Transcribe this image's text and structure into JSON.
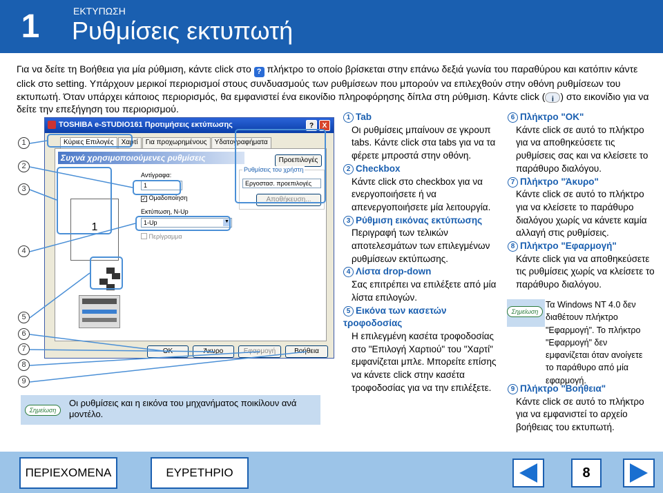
{
  "header": {
    "chapter_number": "1",
    "section_label": "ΕΚΤΥΠΩΣΗ",
    "title": "Ρυθμίσεις εκτυπωτή"
  },
  "intro": {
    "part1": "Για να δείτε τη Βοήθεια για μία ρύθμιση, κάντε click στο",
    "q_icon": "?",
    "part2": "πλήκτρο το οποίο βρίσκεται στην επάνω δεξιά γωνία του παραθύρου και κατόπιν κάντε click στο setting. Υπάρχουν μερικοί περιορισμοί στους συνδυασμούς των ρυθμίσεων που μπορούν να επιλεχθούν στην οθόνη ρυθμίσεων του εκτυπωτή. Όταν υπάρχει κάποιος περιορισμός, θα εμφανιστεί ένα εικονίδιο πληροφόρησης δίπλα στη ρύθμιση. Κάντε click (",
    "i_icon": "i",
    "part3": ") στο εικονίδιο για να δείτε την επεξήγηση του περιορισμού."
  },
  "callouts": [
    "1",
    "2",
    "3",
    "4",
    "5",
    "6",
    "7",
    "8",
    "9"
  ],
  "dialog": {
    "title": "TOSHIBA e-STUDIO161 Προτιμήσεις εκτύπωσης",
    "help_btn": "?",
    "close_btn": "X",
    "tabs": [
      "Κύριες Επιλογές",
      "Χαρτί",
      "Για προχωρημένους",
      "Υδατογραφήματα"
    ],
    "banner": "Συχνά χρησιμοποιούμενες ρυθμίσεις",
    "defaults_btn": "Προεπιλογές",
    "preview_number": "1",
    "copies_label": "Αντίγραφα:",
    "copies_value": "1",
    "collate_label": "Ομαδοποίηση",
    "user_settings_label": "Ρυθμίσεις του χρήστη",
    "user_settings_value": "Εργοστασ. προεπιλογές",
    "save_btn": "Αποθήκευση...",
    "nup_label": "Εκτύπωση, N-Up",
    "nup_value": "1-Up",
    "border_label": "Περίγραμμα",
    "ok_btn": "OK",
    "cancel_btn": "Άκυρο",
    "apply_btn": "Εφαρμογή",
    "help_bottom_btn": "Βοήθεια"
  },
  "note": {
    "badge": "Σημείωση",
    "text": "Οι ρυθμίσεις και η εικόνα του μηχανήματος ποικίλουν ανά μοντέλο."
  },
  "items_col1": [
    {
      "n": "1",
      "head": "Tab",
      "body": "Οι ρυθμίσεις μπαίνουν σε γκρουπ tabs. Κάντε click στα tabs για να τα φέρετε μπροστά στην οθόνη."
    },
    {
      "n": "2",
      "head": "Checkbox",
      "body": "Κάντε click στο checkbox για να ενεργοποιήσετε ή να απενεργοποιήσετε μία λειτουργία."
    },
    {
      "n": "3",
      "head": "Ρύθμιση εικόνας εκτύπωσης",
      "body": "Περιγραφή των τελικών αποτελεσμάτων των επιλεγμένων ρυθμίσεων εκτύπωσης."
    },
    {
      "n": "4",
      "head": "Λίστα drop-down",
      "body": "Σας επιτρέπει να επιλέξετε από μία λίστα επιλογών."
    },
    {
      "n": "5",
      "head": "Εικόνα των κασετών τροφοδοσίας",
      "body": "Η επιλεγμένη κασέτα τροφοδοσίας στο \"Επιλογή Χαρτιού\" του \"Χαρτί\" εμφανίζεται μπλε. Μπορείτε επίσης να κάνετε click στην κασέτα τροφοδοσίας για να την επιλέξετε."
    }
  ],
  "items_col2": [
    {
      "n": "6",
      "head": "Πλήκτρο \"OK\"",
      "body": "Κάντε click σε αυτό το πλήκτρο για να αποθηκεύσετε τις ρυθμίσεις σας και να κλείσετε το παράθυρο διαλόγου."
    },
    {
      "n": "7",
      "head": "Πλήκτρο \"Άκυρο\"",
      "body": "Κάντε click σε αυτό το πλήκτρο για να κλείσετε το παράθυρο διαλόγου χωρίς να κάνετε καμία αλλαγή στις ρυθμίσεις."
    },
    {
      "n": "8",
      "head": "Πλήκτρο \"Εφαρμογή\"",
      "body": "Κάντε click για να αποθηκεύσετε τις ρυθμίσεις χωρίς να κλείσετε το παράθυρο διαλόγου."
    }
  ],
  "note2": {
    "badge": "Σημείωση",
    "text": "Τα Windows NT 4.0 δεν διαθέτουν πλήκτρο \"Εφαρμογή\". Το πλήκτρο \"Εφαρμογή\" δεν εμφανίζεται όταν ανοίγετε το παράθυρο από μία εφαρμογή."
  },
  "item9": {
    "n": "9",
    "head": "Πλήκτρο \"Βοήθεια\"",
    "body": "Κάντε click σε αυτό το πλήκτρο για να εμφανιστεί το αρχείο βοήθειας του εκτυπωτή."
  },
  "footer": {
    "contents_btn": "ΠΕΡΙΕΧΟΜΕΝΑ",
    "index_btn": "ΕΥΡΕΤΗΡΙΟ",
    "page_number": "8"
  }
}
